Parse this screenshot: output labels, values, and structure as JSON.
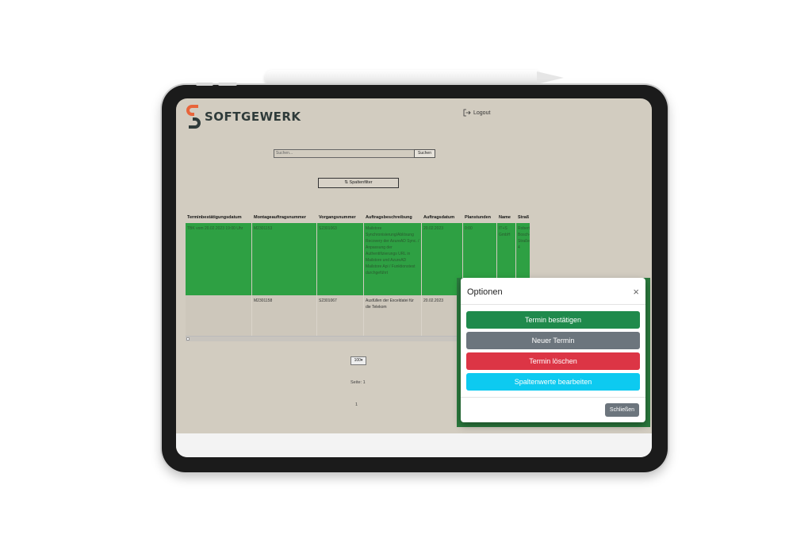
{
  "app": {
    "logo_text": "SOFTGEWERK",
    "logout_label": "Logout"
  },
  "search": {
    "placeholder": "Suchen...",
    "button_label": "Suchen"
  },
  "column_filter_label": "Spaltenfilter",
  "table": {
    "headers": [
      "Terminbestätigungsdatum",
      "Montageauftragsnummer",
      "Vorgangsnummer",
      "Auftragsbeschreibung",
      "Auftragsdatum",
      "Planstunden",
      "Name",
      "Straß"
    ],
    "rows": [
      [
        "TBK vom 20.02.2023 19:00 Uhr",
        "M2301153",
        "S2301063",
        "Mailstore Synchronisierung/Ablösung Recovery der AzureAD Sync. / Anpassung der Authentifizierungs URL in Mailstore und AzureAD Mailstore Api / Funktionstest durchgeführt",
        "20.02.2023",
        "0:00",
        "IT+S GmbH",
        "Robert-Bosch-Straße 4"
      ],
      [
        "",
        "M2301158",
        "S2301067",
        "Ausfüllen der Exceldatei für die Telekom",
        "20.02.2023",
        "",
        "",
        ""
      ]
    ]
  },
  "pagination": {
    "page_size": "100",
    "page_label": "Seite: 1",
    "current_page": "1"
  },
  "modal": {
    "title": "Optionen",
    "close_symbol": "×",
    "buttons": [
      {
        "label": "Termin bestätigen",
        "color": "#1f8a4c"
      },
      {
        "label": "Neuer Termin",
        "color": "#6c757d"
      },
      {
        "label": "Termin löschen",
        "color": "#dc3545"
      },
      {
        "label": "Spaltenwerte bearbeiten",
        "color": "#0dcaf0"
      }
    ],
    "close_button_label": "Schließen"
  },
  "colors": {
    "background": "#d2ccc0",
    "row_highlight": "#2ea043",
    "logo_orange": "#e8643a",
    "logo_dark": "#2f3b3a"
  }
}
